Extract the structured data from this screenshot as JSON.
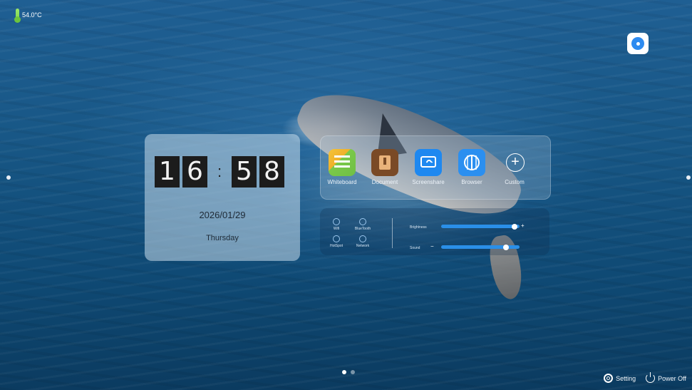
{
  "status": {
    "temperature": "54.0°C"
  },
  "clock": {
    "h1": "1",
    "h2": "6",
    "separator": ":",
    "m1": "5",
    "m2": "8",
    "date": "2026/01/29",
    "weekday": "Thursday"
  },
  "apps": [
    {
      "label": "Whiteboard",
      "icon": "whiteboard-icon"
    },
    {
      "label": "Document",
      "icon": "document-icon"
    },
    {
      "label": "Screenshare",
      "icon": "screenshare-icon"
    },
    {
      "label": "Browser",
      "icon": "browser-icon"
    },
    {
      "label": "Custom",
      "icon": "plus-icon"
    }
  ],
  "quick_toggles": [
    {
      "label": "Wifi",
      "icon": "wifi-icon"
    },
    {
      "label": "BlueTooth",
      "icon": "bluetooth-icon"
    },
    {
      "label": "HotSpot",
      "icon": "hotspot-icon"
    },
    {
      "label": "Network",
      "icon": "network-icon"
    }
  ],
  "sliders": {
    "brightness": {
      "label": "Brightness",
      "value": 0.94
    },
    "sound": {
      "label": "Sound",
      "value": 0.83
    }
  },
  "pagination": {
    "pages": 2,
    "current": 1
  },
  "footer": {
    "setting_label": "Setting",
    "power_label": "Power Off"
  },
  "colors": {
    "accent": "#2a8fe8",
    "clock_tile": "#1c1c1c"
  }
}
